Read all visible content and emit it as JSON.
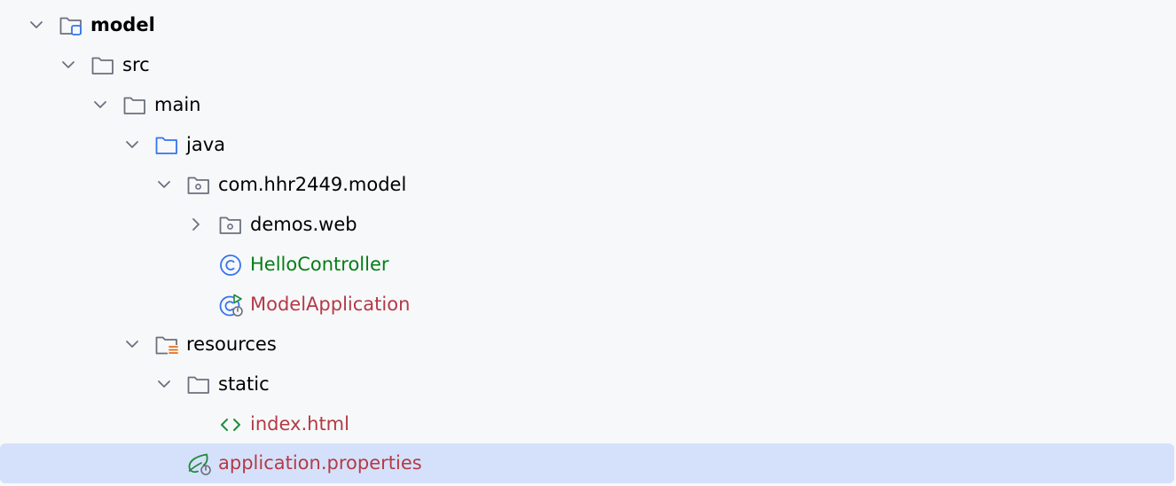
{
  "colors": {
    "background": "#f7f8fa",
    "selection": "#d5e1fb",
    "default_text": "#000000",
    "green_text": "#067d17",
    "red_text": "#b43a45",
    "folder_icon": "#6c707e",
    "source_folder_icon": "#3574f0",
    "resources_icon": "#e66d17",
    "spring_icon": "#208a3c"
  },
  "tree": {
    "model": "model",
    "src": "src",
    "main": "main",
    "java": "java",
    "package": "com.hhr2449.model",
    "demos_web": "demos.web",
    "hello_controller": "HelloController",
    "model_application": "ModelApplication",
    "resources": "resources",
    "static": "static",
    "index_html": "index.html",
    "application_properties": "application.properties"
  },
  "icons": {
    "model": "module-folder-icon",
    "src": "folder-icon",
    "main": "folder-icon",
    "java": "source-folder-icon",
    "package": "package-icon",
    "demos_web": "package-icon",
    "hello_controller": "class-icon",
    "model_application": "spring-boot-class-icon",
    "resources": "resources-folder-icon",
    "static": "folder-icon",
    "index_html": "html-file-icon",
    "application_properties": "spring-properties-icon"
  }
}
